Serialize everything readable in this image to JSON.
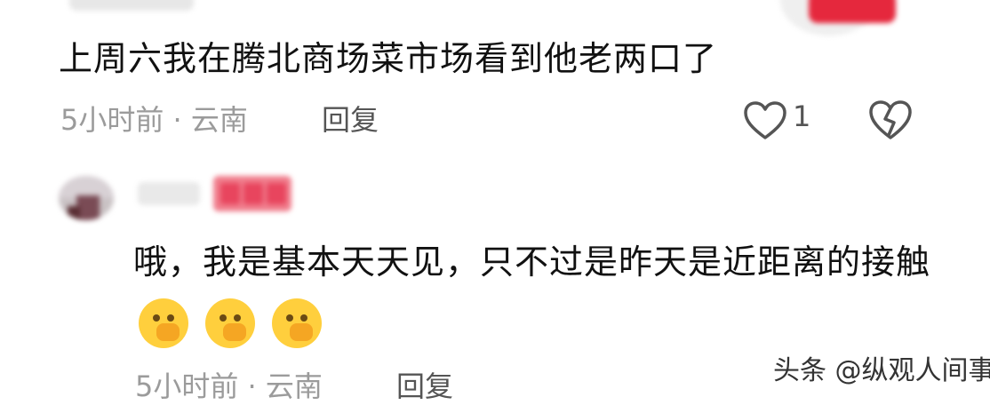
{
  "comment1": {
    "text": "上周六我在腾北商场菜市场看到他老两口了",
    "meta": "5小时前 · 云南",
    "reply_label": "回复",
    "like_count": "1"
  },
  "comment2": {
    "text": "哦，我是基本天天见，只不过是昨天是近距离的接触",
    "emoji_icon": "face-with-hand-over-mouth",
    "meta": "5小时前 · 云南",
    "reply_label": "回复"
  },
  "watermark": "头条 @纵观人间事",
  "colors": {
    "badge": "#e8455e",
    "meta": "#9b9b9b",
    "emoji": "#ffcf3d"
  }
}
